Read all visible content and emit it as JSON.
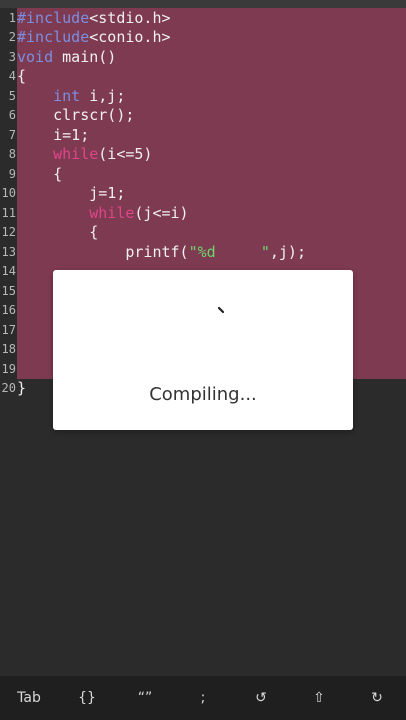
{
  "editor": {
    "lines": [
      {
        "n": "1",
        "parts": [
          {
            "t": "#include",
            "c": "kw-blue"
          },
          {
            "t": "<stdio.h>"
          }
        ]
      },
      {
        "n": "2",
        "parts": [
          {
            "t": "#include",
            "c": "kw-blue"
          },
          {
            "t": "<conio.h>"
          }
        ]
      },
      {
        "n": "3",
        "parts": [
          {
            "t": "void",
            "c": "kw-blue"
          },
          {
            "t": " main()"
          }
        ]
      },
      {
        "n": "4",
        "parts": [
          {
            "t": "{"
          }
        ]
      },
      {
        "n": "5",
        "parts": [
          {
            "t": "    "
          },
          {
            "t": "int",
            "c": "kw-blue"
          },
          {
            "t": " i,j;"
          }
        ]
      },
      {
        "n": "6",
        "parts": [
          {
            "t": "    clrscr();"
          }
        ]
      },
      {
        "n": "7",
        "parts": [
          {
            "t": "    i=1;"
          }
        ]
      },
      {
        "n": "8",
        "parts": [
          {
            "t": "    "
          },
          {
            "t": "while",
            "c": "kw-pink"
          },
          {
            "t": "(i<=5)"
          }
        ]
      },
      {
        "n": "9",
        "parts": [
          {
            "t": "    {"
          }
        ]
      },
      {
        "n": "10",
        "parts": [
          {
            "t": "        j=1;"
          }
        ]
      },
      {
        "n": "11",
        "parts": [
          {
            "t": "        "
          },
          {
            "t": "while",
            "c": "kw-pink"
          },
          {
            "t": "(j<=i)"
          }
        ]
      },
      {
        "n": "12",
        "parts": [
          {
            "t": "        {"
          }
        ]
      },
      {
        "n": "13",
        "parts": [
          {
            "t": "            printf("
          },
          {
            "t": "\"%d     \"",
            "c": "str-green"
          },
          {
            "t": ",j);"
          }
        ]
      },
      {
        "n": "14",
        "parts": [
          {
            "t": ""
          }
        ]
      },
      {
        "n": "15",
        "parts": [
          {
            "t": ""
          }
        ]
      },
      {
        "n": "16",
        "parts": [
          {
            "t": ""
          }
        ]
      },
      {
        "n": "17",
        "parts": [
          {
            "t": ""
          }
        ]
      },
      {
        "n": "18",
        "parts": [
          {
            "t": ""
          }
        ]
      },
      {
        "n": "19",
        "parts": [
          {
            "t": ""
          }
        ]
      },
      {
        "n": "20",
        "parts": [
          {
            "t": "}"
          }
        ]
      }
    ]
  },
  "dialog": {
    "message": "Compiling..."
  },
  "keys": [
    {
      "label": "Tab",
      "name": "tab-key"
    },
    {
      "label": "{}",
      "name": "braces-key"
    },
    {
      "label": "“”",
      "name": "quotes-key"
    },
    {
      "label": ";",
      "name": "semicolon-key"
    },
    {
      "label": "↺",
      "name": "undo-key"
    },
    {
      "label": "⇧",
      "name": "shift-key"
    },
    {
      "label": "↻",
      "name": "redo-key"
    }
  ],
  "colors": {
    "selection": "#7e3a50",
    "keyword_blue": "#7b8fe0",
    "keyword_pink": "#e0458a",
    "string_green": "#6fd36f"
  }
}
